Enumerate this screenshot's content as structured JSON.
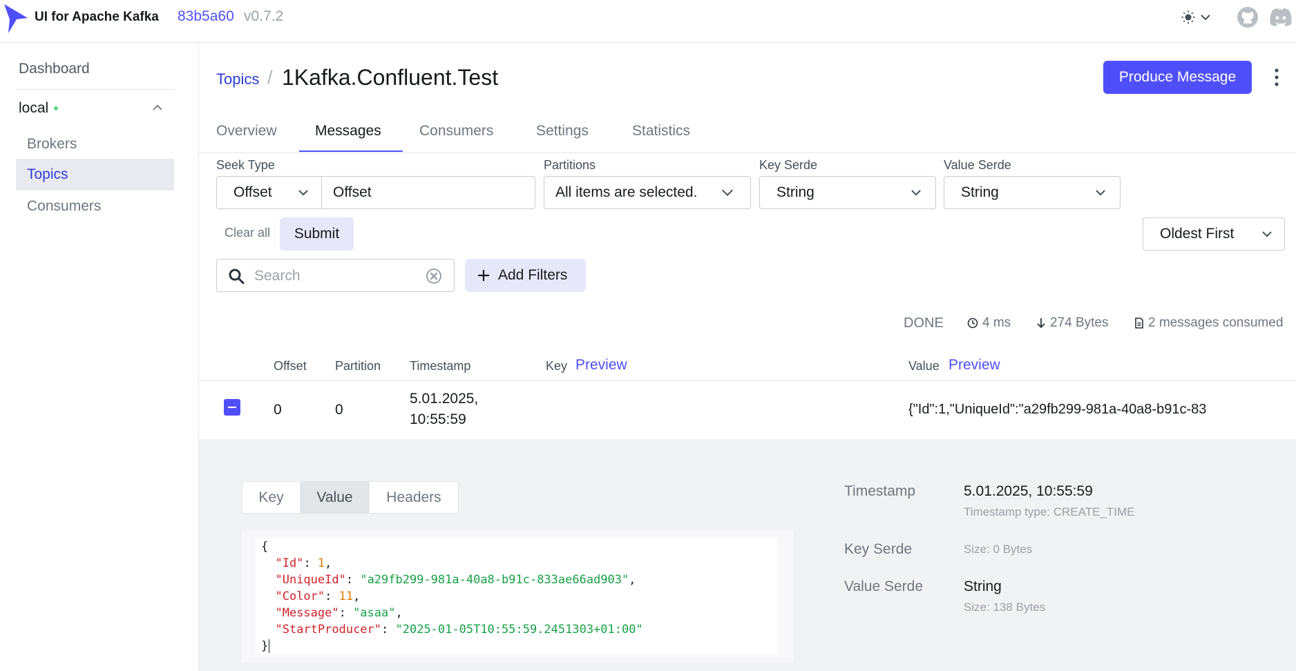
{
  "header": {
    "app_title": "UI for Apache Kafka",
    "version_hash": "83b5a60",
    "version_number": "v0.7.2",
    "brand_color": "#4f4ffa"
  },
  "sidebar": {
    "dashboard": "Dashboard",
    "cluster_name": "local",
    "cluster_status_color": "#5cd685",
    "items": [
      {
        "label": "Brokers"
      },
      {
        "label": "Topics"
      },
      {
        "label": "Consumers"
      }
    ]
  },
  "breadcrumb": {
    "topics": "Topics",
    "separator": "/",
    "topic_name": "1Kafka.Confluent.Test"
  },
  "actions": {
    "produce_message": "Produce Message"
  },
  "tabs": [
    {
      "label": "Overview"
    },
    {
      "label": "Messages"
    },
    {
      "label": "Consumers"
    },
    {
      "label": "Settings"
    },
    {
      "label": "Statistics"
    }
  ],
  "filters": {
    "seek_type_label": "Seek Type",
    "seek_type_value": "Offset",
    "offset_value": "Offset",
    "partitions_label": "Partitions",
    "partitions_value": "All items are selected.",
    "key_serde_label": "Key Serde",
    "key_serde_value": "String",
    "value_serde_label": "Value Serde",
    "value_serde_value": "String",
    "clear_all": "Clear all",
    "submit": "Submit",
    "sort_order": "Oldest First",
    "search_placeholder": "Search",
    "add_filters": "Add Filters"
  },
  "status": {
    "state": "DONE",
    "elapsed": "4 ms",
    "bytes": "274 Bytes",
    "consumed": "2 messages consumed"
  },
  "table": {
    "headers": {
      "offset": "Offset",
      "partition": "Partition",
      "timestamp": "Timestamp",
      "key": "Key",
      "key_preview": "Preview",
      "value": "Value",
      "value_preview": "Preview"
    },
    "rows": [
      {
        "offset": "0",
        "partition": "0",
        "timestamp_date": "5.01.2025,",
        "timestamp_time": "10:55:59",
        "key": "",
        "value": "{\"Id\":1,\"UniqueId\":\"a29fb299-981a-40a8-b91c-83"
      }
    ]
  },
  "detail": {
    "tabs": [
      "Key",
      "Value",
      "Headers"
    ],
    "json": {
      "open": "{",
      "close": "}",
      "id_key": "\"Id\"",
      "id_val": "1",
      "uid_key": "\"UniqueId\"",
      "uid_val": "\"a29fb299-981a-40a8-b91c-833ae66ad903\"",
      "color_key": "\"Color\"",
      "color_val": "11",
      "msg_key": "\"Message\"",
      "msg_val": "\"asaa\"",
      "sp_key": "\"StartProducer\"",
      "sp_val": "\"2025-01-05T10:55:59.2451303+01:00\""
    },
    "meta": {
      "timestamp_label": "Timestamp",
      "timestamp_value": "5.01.2025, 10:55:59",
      "timestamp_type": "Timestamp type: CREATE_TIME",
      "key_serde_label": "Key Serde",
      "key_size": "Size: 0 Bytes",
      "value_serde_label": "Value Serde",
      "value_serde_value": "String",
      "value_size": "Size: 138 Bytes"
    }
  }
}
